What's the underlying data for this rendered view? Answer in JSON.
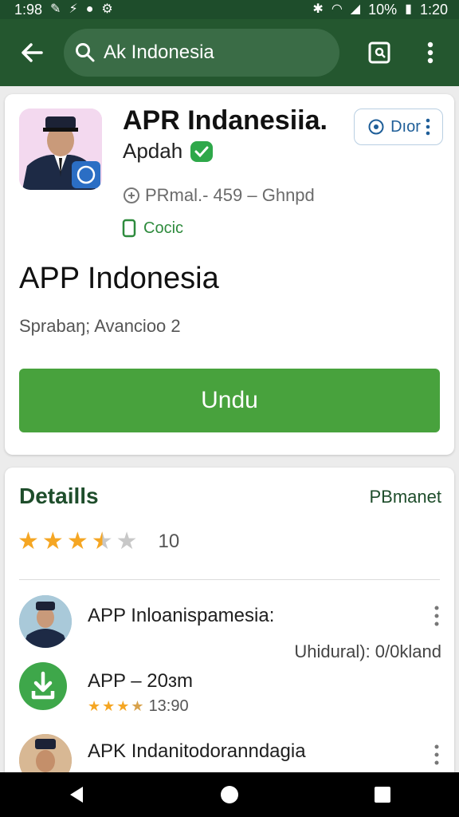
{
  "status_bar": {
    "time_left": "1:98",
    "battery": "10%",
    "time_right": "1:20"
  },
  "search": {
    "query": "Ak Indonesia"
  },
  "app": {
    "title": "APR Indanesiia.",
    "publisher": "Apdah",
    "meta": "PRmal.- 459 – Ghnpd",
    "category": "Cocic",
    "chip_label": "Dıor",
    "name": "APP Indonesia",
    "subtitle": "Sprabaŋ; Avancioo 2",
    "install_label": "Undu"
  },
  "details": {
    "title": "Detaills",
    "link": "PBmanet",
    "rating": 3.5,
    "rating_count": "10",
    "items": [
      {
        "title": "APP Inloanispamesia:",
        "sub": "Uhidural): 0/0kland"
      },
      {
        "title": "APP – 20ɜm",
        "rating_text": "13:90"
      },
      {
        "title": "APK Indanitodoranndagia"
      }
    ]
  },
  "colors": {
    "header": "#24572f",
    "status": "#1e4d2b",
    "install": "#48a23d",
    "star": "#f5a623",
    "star_empty": "#c8c8c8"
  }
}
